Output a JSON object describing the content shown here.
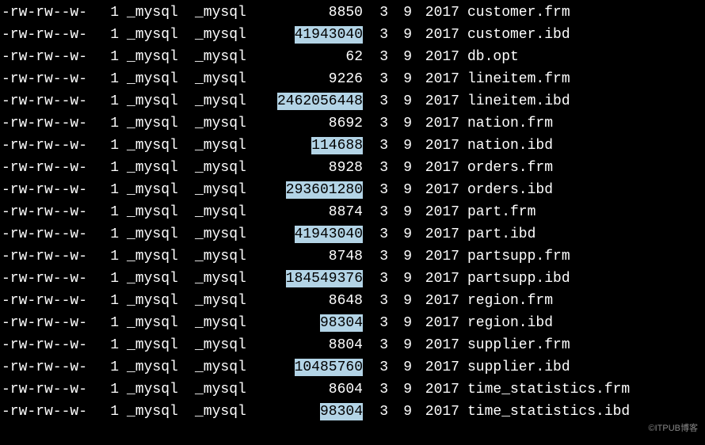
{
  "watermark": "©ITPUB博客",
  "rows": [
    {
      "perms": "-rw-rw--w-",
      "links": "1",
      "owner": "_mysql",
      "group": "_mysql",
      "size": "8850",
      "hl": false,
      "month": "3",
      "day": "9",
      "year": "2017",
      "fname": "customer.frm"
    },
    {
      "perms": "-rw-rw--w-",
      "links": "1",
      "owner": "_mysql",
      "group": "_mysql",
      "size": "41943040",
      "hl": true,
      "month": "3",
      "day": "9",
      "year": "2017",
      "fname": "customer.ibd"
    },
    {
      "perms": "-rw-rw--w-",
      "links": "1",
      "owner": "_mysql",
      "group": "_mysql",
      "size": "62",
      "hl": false,
      "month": "3",
      "day": "9",
      "year": "2017",
      "fname": "db.opt"
    },
    {
      "perms": "-rw-rw--w-",
      "links": "1",
      "owner": "_mysql",
      "group": "_mysql",
      "size": "9226",
      "hl": false,
      "month": "3",
      "day": "9",
      "year": "2017",
      "fname": "lineitem.frm"
    },
    {
      "perms": "-rw-rw--w-",
      "links": "1",
      "owner": "_mysql",
      "group": "_mysql",
      "size": "2462056448",
      "hl": true,
      "month": "3",
      "day": "9",
      "year": "2017",
      "fname": "lineitem.ibd"
    },
    {
      "perms": "-rw-rw--w-",
      "links": "1",
      "owner": "_mysql",
      "group": "_mysql",
      "size": "8692",
      "hl": false,
      "month": "3",
      "day": "9",
      "year": "2017",
      "fname": "nation.frm"
    },
    {
      "perms": "-rw-rw--w-",
      "links": "1",
      "owner": "_mysql",
      "group": "_mysql",
      "size": "114688",
      "hl": true,
      "month": "3",
      "day": "9",
      "year": "2017",
      "fname": "nation.ibd"
    },
    {
      "perms": "-rw-rw--w-",
      "links": "1",
      "owner": "_mysql",
      "group": "_mysql",
      "size": "8928",
      "hl": false,
      "month": "3",
      "day": "9",
      "year": "2017",
      "fname": "orders.frm"
    },
    {
      "perms": "-rw-rw--w-",
      "links": "1",
      "owner": "_mysql",
      "group": "_mysql",
      "size": "293601280",
      "hl": true,
      "month": "3",
      "day": "9",
      "year": "2017",
      "fname": "orders.ibd"
    },
    {
      "perms": "-rw-rw--w-",
      "links": "1",
      "owner": "_mysql",
      "group": "_mysql",
      "size": "8874",
      "hl": false,
      "month": "3",
      "day": "9",
      "year": "2017",
      "fname": "part.frm"
    },
    {
      "perms": "-rw-rw--w-",
      "links": "1",
      "owner": "_mysql",
      "group": "_mysql",
      "size": "41943040",
      "hl": true,
      "month": "3",
      "day": "9",
      "year": "2017",
      "fname": "part.ibd"
    },
    {
      "perms": "-rw-rw--w-",
      "links": "1",
      "owner": "_mysql",
      "group": "_mysql",
      "size": "8748",
      "hl": false,
      "month": "3",
      "day": "9",
      "year": "2017",
      "fname": "partsupp.frm"
    },
    {
      "perms": "-rw-rw--w-",
      "links": "1",
      "owner": "_mysql",
      "group": "_mysql",
      "size": "184549376",
      "hl": true,
      "month": "3",
      "day": "9",
      "year": "2017",
      "fname": "partsupp.ibd"
    },
    {
      "perms": "-rw-rw--w-",
      "links": "1",
      "owner": "_mysql",
      "group": "_mysql",
      "size": "8648",
      "hl": false,
      "month": "3",
      "day": "9",
      "year": "2017",
      "fname": "region.frm"
    },
    {
      "perms": "-rw-rw--w-",
      "links": "1",
      "owner": "_mysql",
      "group": "_mysql",
      "size": "98304",
      "hl": true,
      "month": "3",
      "day": "9",
      "year": "2017",
      "fname": "region.ibd"
    },
    {
      "perms": "-rw-rw--w-",
      "links": "1",
      "owner": "_mysql",
      "group": "_mysql",
      "size": "8804",
      "hl": false,
      "month": "3",
      "day": "9",
      "year": "2017",
      "fname": "supplier.frm"
    },
    {
      "perms": "-rw-rw--w-",
      "links": "1",
      "owner": "_mysql",
      "group": "_mysql",
      "size": "10485760",
      "hl": true,
      "month": "3",
      "day": "9",
      "year": "2017",
      "fname": "supplier.ibd"
    },
    {
      "perms": "-rw-rw--w-",
      "links": "1",
      "owner": "_mysql",
      "group": "_mysql",
      "size": "8604",
      "hl": false,
      "month": "3",
      "day": "9",
      "year": "2017",
      "fname": "time_statistics.frm"
    },
    {
      "perms": "-rw-rw--w-",
      "links": "1",
      "owner": "_mysql",
      "group": "_mysql",
      "size": "98304",
      "hl": true,
      "month": "3",
      "day": "9",
      "year": "2017",
      "fname": "time_statistics.ibd"
    }
  ]
}
